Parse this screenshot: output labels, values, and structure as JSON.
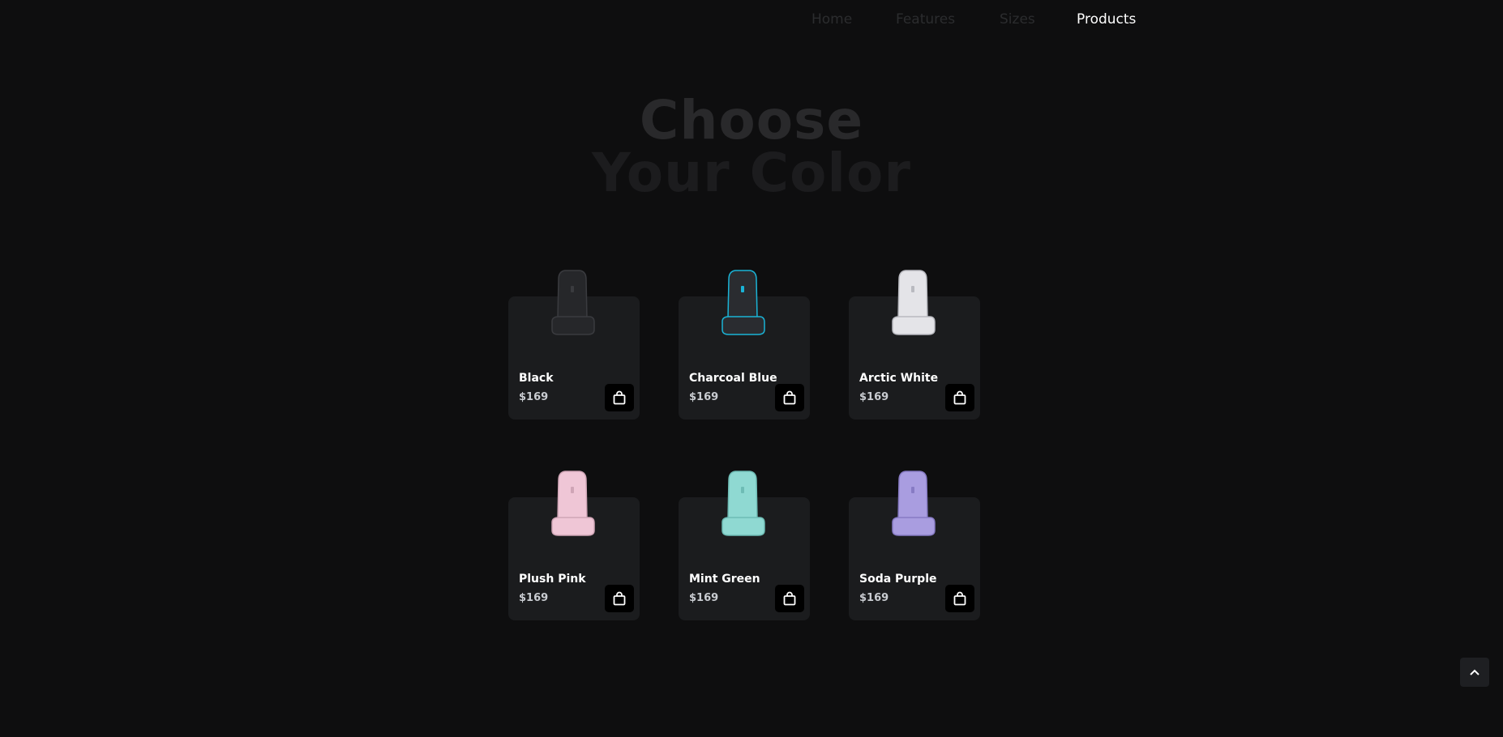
{
  "nav": {
    "links": [
      {
        "label": "Home",
        "active": false
      },
      {
        "label": "Features",
        "active": false
      },
      {
        "label": "Sizes",
        "active": false
      },
      {
        "label": "Products",
        "active": true
      }
    ]
  },
  "hero": {
    "line1": "Choose",
    "line2": "Your Color"
  },
  "products": [
    {
      "name": "Black",
      "price": "$169",
      "color": "#26272a",
      "accent": "#3a3b3f",
      "icon": "chair-image"
    },
    {
      "name": "Charcoal Blue",
      "price": "$169",
      "color": "#2a2c30",
      "accent": "#1ab3d6",
      "icon": "chair-image"
    },
    {
      "name": "Arctic White",
      "price": "$169",
      "color": "#e4e4e8",
      "accent": "#b9bac0",
      "icon": "chair-image"
    },
    {
      "name": "Plush Pink",
      "price": "$169",
      "color": "#efc6d6",
      "accent": "#cfa5b6",
      "icon": "chair-image"
    },
    {
      "name": "Mint Green",
      "price": "$169",
      "color": "#8fd9d2",
      "accent": "#6ebcb5",
      "icon": "chair-image"
    },
    {
      "name": "Soda Purple",
      "price": "$169",
      "color": "#a99de0",
      "accent": "#877bc4",
      "icon": "chair-image"
    }
  ],
  "icons": {
    "cart": "shopping-bag-icon",
    "scroll_top": "chevron-up-icon"
  },
  "colors": {
    "background": "#0e0e0f",
    "card": "#1b1c1e",
    "nav_active": "#ffffff",
    "nav_inactive": "#2b2c2e"
  }
}
